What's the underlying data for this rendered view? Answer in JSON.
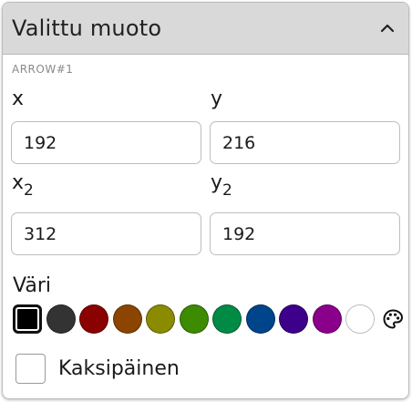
{
  "panel": {
    "title": "Valittu muoto",
    "collapse_icon": "chevron-up-icon",
    "shape_id": "ARROW#1"
  },
  "coords": {
    "x": {
      "label": "x",
      "value": "192"
    },
    "y": {
      "label": "y",
      "value": "216"
    },
    "x2": {
      "label": "x",
      "sub": "2",
      "value": "312"
    },
    "y2": {
      "label": "y",
      "sub": "2",
      "value": "192"
    }
  },
  "color": {
    "label": "Väri",
    "selected_index": 0,
    "swatches": [
      "#000000",
      "#333333",
      "#8b0000",
      "#8b4500",
      "#8b8b00",
      "#3d8b00",
      "#008b45",
      "#00458b",
      "#3d008b",
      "#8b008b",
      "#ffffff"
    ],
    "palette_icon": "palette-icon"
  },
  "double_sided": {
    "label": "Kaksipäinen",
    "checked": false
  }
}
